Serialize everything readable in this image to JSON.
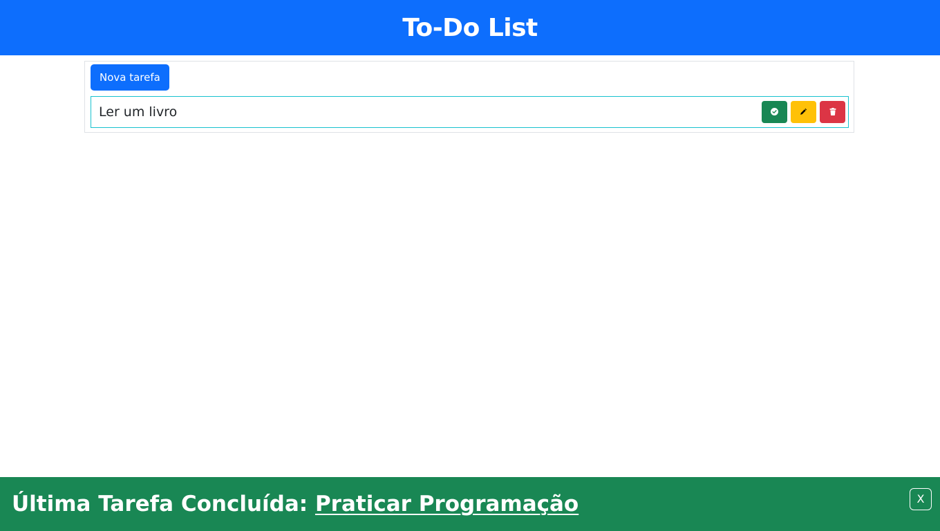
{
  "header": {
    "title": "To-Do List"
  },
  "toolbar": {
    "new_task_label": "Nova tarefa"
  },
  "tasks": [
    {
      "label": "Ler um livro",
      "actions": [
        {
          "name": "complete",
          "icon": "check-circle-icon",
          "color": "#198754"
        },
        {
          "name": "edit",
          "icon": "pencil-icon",
          "color": "#ffc107"
        },
        {
          "name": "delete",
          "icon": "trash-icon",
          "color": "#dc3545"
        }
      ]
    }
  ],
  "footer": {
    "prefix": "Última Tarefa Concluída: ",
    "task_link": "Praticar Programação",
    "close_label": "X"
  },
  "colors": {
    "primary": "#0d6efd",
    "success": "#198754",
    "warning": "#ffc107",
    "danger": "#dc3545",
    "task_border": "#17c1cf"
  }
}
